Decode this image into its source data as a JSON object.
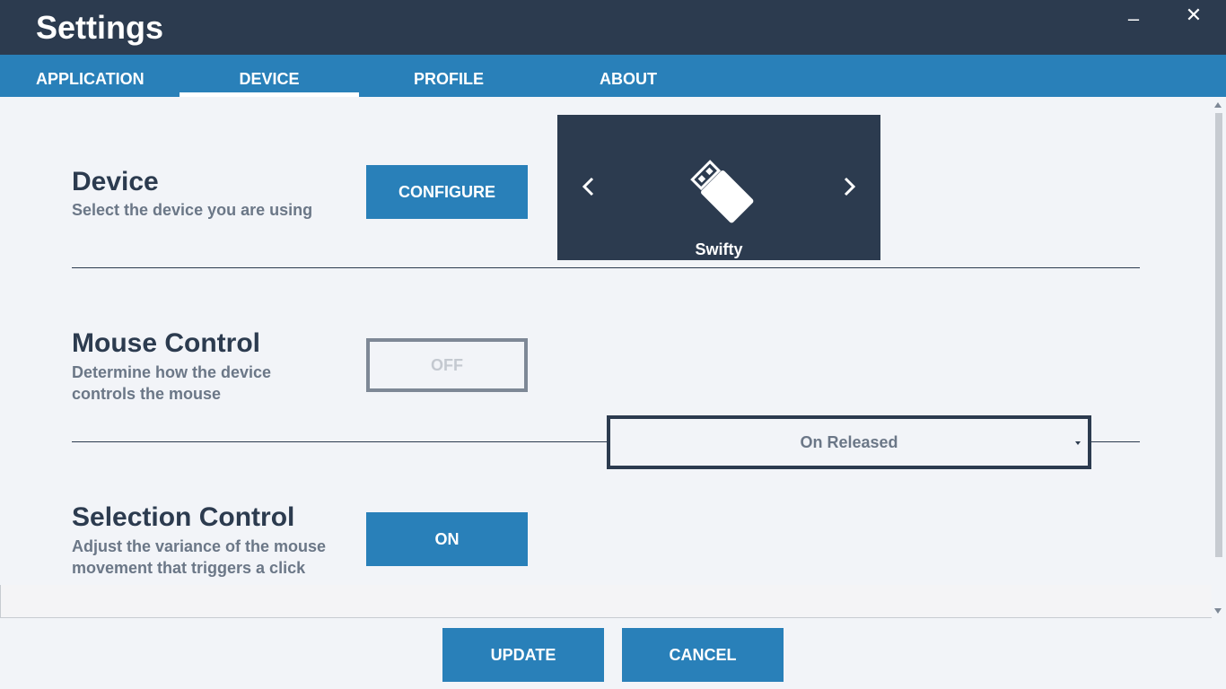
{
  "window": {
    "title": "Settings",
    "minimize_label": "–",
    "close_label": "✕"
  },
  "tabs": [
    {
      "label": "APPLICATION"
    },
    {
      "label": "DEVICE",
      "active": true
    },
    {
      "label": "PROFILE"
    },
    {
      "label": "ABOUT"
    }
  ],
  "device_section": {
    "title": "Device",
    "description": "Select the device you are using",
    "button_label": "CONFIGURE",
    "selected_device": "Swifty",
    "icon": "usb-drive-icon"
  },
  "mouse_control_section": {
    "title": "Mouse Control",
    "description": "Determine how the device controls the mouse",
    "toggle_label": "OFF"
  },
  "selection_control_section": {
    "title": "Selection Control",
    "description": "Adjust the variance of the mouse movement that triggers a click",
    "toggle_label": "ON",
    "select_value": "On Released"
  },
  "footer": {
    "update_label": "UPDATE",
    "cancel_label": "CANCEL"
  },
  "colors": {
    "titlebar": "#2c3b4f",
    "accent": "#2980b9",
    "background": "#f2f4f8"
  }
}
